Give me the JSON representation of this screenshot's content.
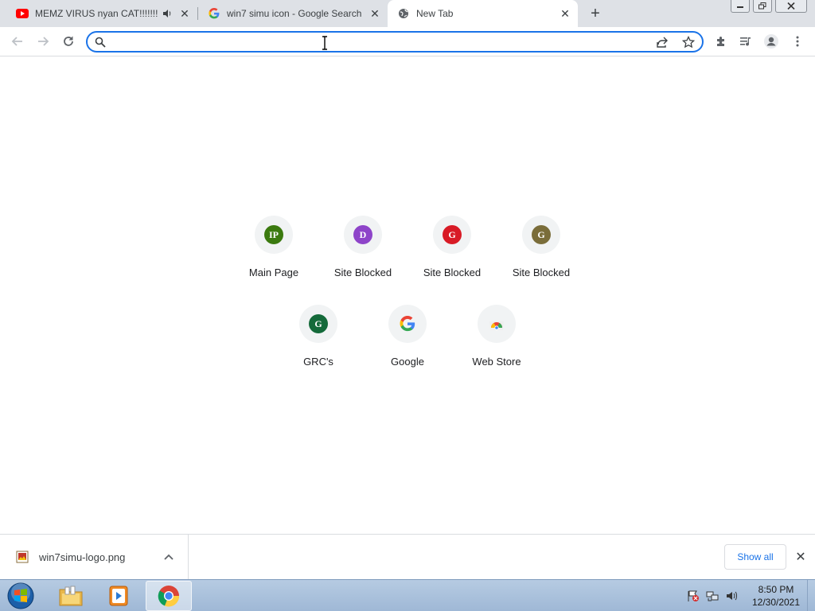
{
  "tabs": [
    {
      "title": "MEMZ VIRUS nyan CAT!!!!!!!",
      "favicon": "youtube-icon",
      "audio": true
    },
    {
      "title": "win7 simu icon - Google Search",
      "favicon": "google-icon"
    },
    {
      "title": "New Tab",
      "favicon": "globe-icon",
      "active": true
    }
  ],
  "omnibox": {
    "value": "",
    "placeholder": ""
  },
  "shortcuts": [
    {
      "label": "Main Page",
      "letter": "IP",
      "color": "#3b7a0f"
    },
    {
      "label": "Site Blocked",
      "letter": "D",
      "color": "#8e44c9"
    },
    {
      "label": "Site Blocked",
      "letter": "G",
      "color": "#d81b26"
    },
    {
      "label": "Site Blocked",
      "letter": "G",
      "color": "#7a6d3a"
    },
    {
      "label": "GRC's",
      "letter": "G",
      "color": "#146a3a"
    },
    {
      "label": "Google",
      "icon": "google-icon"
    },
    {
      "label": "Web Store",
      "icon": "web-store-icon"
    }
  ],
  "download": {
    "filename": "win7simu-logo.png",
    "show_all": "Show all"
  },
  "taskbar": {
    "time": "8:50 PM",
    "date": "12/30/2021"
  },
  "colors": {
    "accent": "#1a73e8",
    "tabstrip": "#dee1e6"
  }
}
